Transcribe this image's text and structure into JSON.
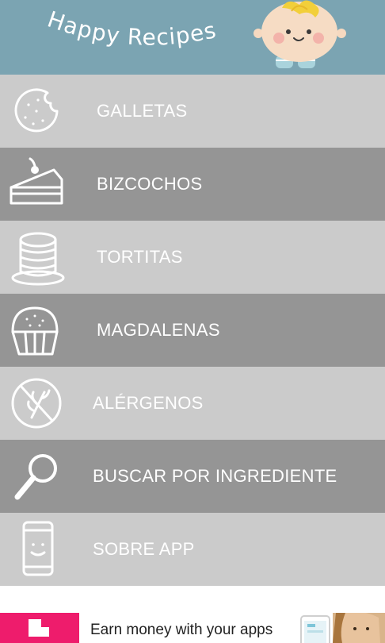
{
  "header": {
    "title": "Happy Recipes"
  },
  "menu": {
    "items": [
      {
        "label": "GALLETAS",
        "icon": "cookie-icon"
      },
      {
        "label": "BIZCOCHOS",
        "icon": "cake-slice-icon"
      },
      {
        "label": "TORTITAS",
        "icon": "pancakes-icon"
      },
      {
        "label": "MAGDALENAS",
        "icon": "muffin-icon"
      },
      {
        "label": "ALÉRGENOS",
        "icon": "no-wheat-icon"
      },
      {
        "label": "BUSCAR POR INGREDIENTE",
        "icon": "magnifier-icon"
      },
      {
        "label": "SOBRE APP",
        "icon": "smiling-phone-icon"
      }
    ]
  },
  "ad": {
    "text": "Earn money with your apps"
  },
  "colors": {
    "header_bg": "#7ba4b2",
    "row_light": "#cbcbcb",
    "row_dark": "#959595",
    "ad_brand": "#ee1c6c"
  }
}
